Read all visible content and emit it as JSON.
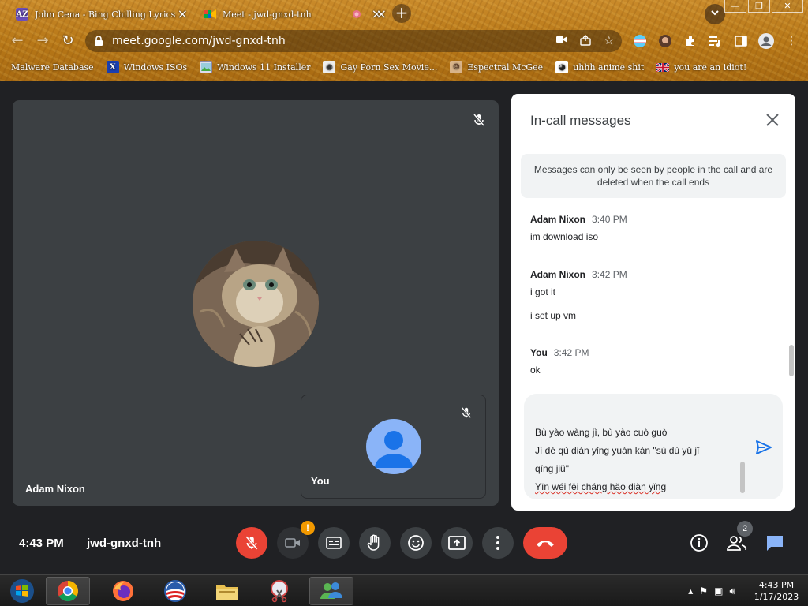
{
  "browser": {
    "tabs": [
      {
        "title": "John Cena - Bing Chilling Lyrics |",
        "favicon": "AZ"
      },
      {
        "title": "Meet - jwd-gnxd-tnh",
        "favicon": ""
      },
      {
        "title": "",
        "favicon": ""
      }
    ],
    "new_tab": "+",
    "url": "meet.google.com/jwd-gnxd-tnh",
    "bookmarks": [
      {
        "label": "Malware Database",
        "icon": "bookmark-icon"
      },
      {
        "label": "Windows ISOs",
        "icon": "x-icon"
      },
      {
        "label": "Windows 11 Installer",
        "icon": "image-icon"
      },
      {
        "label": "Gay Porn Sex Movie...",
        "icon": "bookmark-icon"
      },
      {
        "label": "Espectral McGee",
        "icon": "bookmark-icon"
      },
      {
        "label": "uhhh anime shit",
        "icon": "bookmark-icon"
      },
      {
        "label": "you are an idiot!",
        "icon": "flag-icon"
      }
    ]
  },
  "meet": {
    "main_participant": "Adam Nixon",
    "self_label": "You",
    "panel": {
      "title": "In-call messages",
      "notice": "Messages can only be seen by people in the call and are deleted when the call ends",
      "messages": [
        {
          "sender": "Adam Nixon",
          "time": "3:40 PM",
          "lines": [
            "im download iso"
          ]
        },
        {
          "sender": "Adam Nixon",
          "time": "3:42 PM",
          "lines": [
            "i got it",
            "i set up vm"
          ]
        },
        {
          "sender": "You",
          "time": "3:42 PM",
          "lines": [
            "ok"
          ]
        }
      ],
      "compose_lines": [
        "Bù yào wàng jì, bù yào cuò guò",
        "Jì dé qù diàn yǐng yuàn kàn \"sù dù yǔ jī",
        "qíng jiǔ\"",
        "Yīn wéi fēi cháng hǎo diàn yǐng"
      ]
    },
    "controls": {
      "time": "4:43 PM",
      "meeting_code": "jwd-gnxd-tnh",
      "camera_warning": "!",
      "people_count": "2"
    }
  },
  "taskbar": {
    "time": "4:43 PM",
    "date": "1/17/2023"
  },
  "colors": {
    "meet_bg": "#202124",
    "tile_bg": "#3c4043",
    "red": "#ea4335",
    "blue": "#1a73e8",
    "warn": "#f29900"
  }
}
